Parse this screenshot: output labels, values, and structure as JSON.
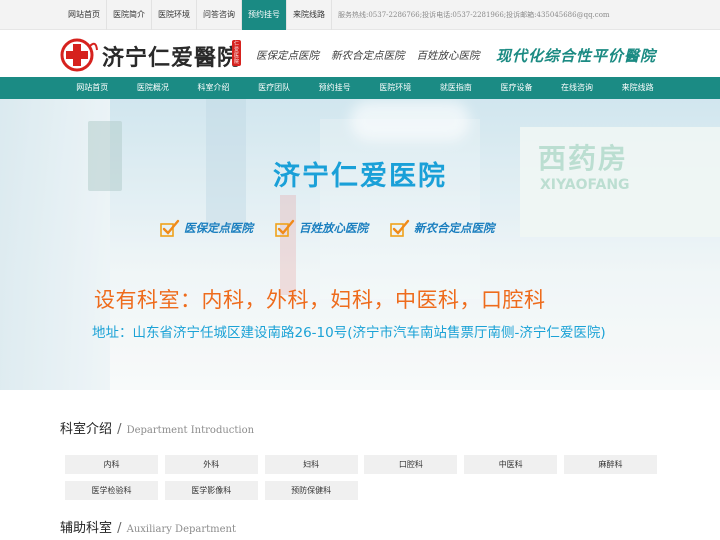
{
  "topbar": {
    "nav": [
      "网站首页",
      "医院简介",
      "医院环境",
      "问答咨询",
      "预约挂号",
      "来院线路"
    ],
    "active_index": 4,
    "contact": "服务热线:0537-2286766;投诉电话:0537-2281966;投诉邮箱:435045686@qq.com",
    "accent_color": "#1a8a83"
  },
  "header": {
    "logo_name": "济宁仁爱醫院",
    "logo_seal": "仁爱医院",
    "slogans": [
      "医保定点医院",
      "新农合定点医院",
      "百姓放心医院"
    ],
    "tagline": "现代化综合性平价醫院"
  },
  "mainnav": {
    "items": [
      "网站首页",
      "医院概况",
      "科室介绍",
      "医疗团队",
      "预约挂号",
      "医院环境",
      "就医指南",
      "医疗设备",
      "在线咨询",
      "来院线路"
    ],
    "bg_color": "#1b8b84"
  },
  "banner": {
    "title": "济宁仁爱医院",
    "badges": [
      "医保定点医院",
      "百姓放心医院",
      "新农合定点医院"
    ],
    "departments_line": "设有科室：内科，外科，妇科，中医科，口腔科",
    "address_line": "地址：山东省济宁任城区建设南路26-10号(济宁市汽车南站售票厅南侧-济宁仁爱医院)",
    "background_sign": "西药房",
    "background_sign_sub": "XIYAOFANG"
  },
  "sections": {
    "departments": {
      "title_zh": "科室介绍",
      "title_en": "Department Introduction",
      "items": [
        "内科",
        "外科",
        "妇科",
        "口腔科",
        "中医科",
        "麻醉科",
        "医学检验科",
        "医学影像科",
        "预防保健科"
      ]
    },
    "auxiliary": {
      "title_zh": "辅助科室",
      "title_en": "Auxiliary Department"
    },
    "separator": "/"
  }
}
